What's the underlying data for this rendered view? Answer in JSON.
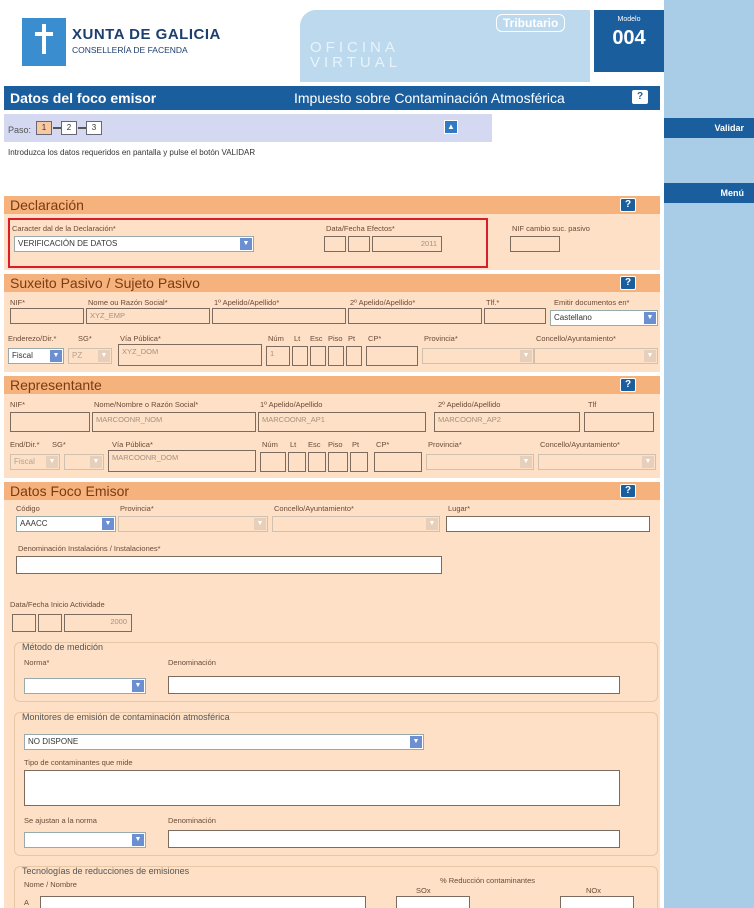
{
  "sidebar": {
    "validar": "Validar",
    "menu": "Menú"
  },
  "header": {
    "logo_title": "XUNTA DE GALICIA",
    "logo_sub": "CONSELLERÍA DE FACENDA",
    "oficina_l1": "OFICINA",
    "oficina_l2": "VIRTUAL",
    "tributario": "Tributario",
    "modelo_label": "Modelo",
    "modelo_num": "004"
  },
  "titlebar": {
    "left": "Datos del foco emisor",
    "right": "Impuesto sobre Contaminación Atmosférica",
    "help": "?"
  },
  "paso": {
    "label": "Paso:",
    "steps": [
      "1",
      "2",
      "3"
    ],
    "instructions": "Introduzca los datos requeridos en pantalla y pulse el botón VALIDAR"
  },
  "declaracion": {
    "title": "Declaración",
    "caracter_label": "Caracter dal de la Declaración*",
    "caracter_value": "VERIFICACIÓN DE DATOS",
    "data_label": "Data/Fecha Efectos*",
    "data_year": "2011",
    "nif_cambio_label": "NIF cambio suc. pasivo"
  },
  "sujeto": {
    "title": "Suxeito Pasivo / Sujeto Pasivo",
    "nif": "NIF*",
    "nome": "Nome ou Razón Social*",
    "nome_value": "XYZ_EMP",
    "ap1": "1º Apelido/Apellido*",
    "ap2": "2º Apelido/Apellido*",
    "tlf": "Tlf.*",
    "emitir": "Emitir documentos en*",
    "idioma": "Castellano",
    "enderezo": "Enderezo/Dir.*",
    "sg": "SG*",
    "enderezo_value": "Fiscal",
    "sg_value": "PZ",
    "via": "Vía Pública*",
    "via_value": "XYZ_DOM",
    "num": "Núm",
    "lt": "Lt",
    "esc": "Esc",
    "piso": "Piso",
    "pt": "Pt",
    "cp": "CP*",
    "provincia": "Provincia*",
    "concello": "Concello/Ayuntamiento*",
    "num_value": "1"
  },
  "representante": {
    "title": "Representante",
    "nif": "NIF*",
    "nome": "Nome/Nombre o Razón Social*",
    "nome_value": "MARCOONR_NOM",
    "ap1": "1º Apelido/Apellido",
    "ap1_value": "MARCOONR_AP1",
    "ap2": "2º Apelido/Apellido",
    "ap2_value": "MARCOONR_AP2",
    "tlf": "Tlf",
    "enderezo": "End/Dir.*",
    "sg": "SG*",
    "enderezo_value": "Fiscal",
    "via": "Vía Pública*",
    "via_value": "MARCOONR_DOM",
    "num": "Núm",
    "lt": "Lt",
    "esc": "Esc",
    "piso": "Piso",
    "pt": "Pt",
    "cp": "CP*",
    "provincia": "Provincia*",
    "concello": "Concello/Ayuntamiento*"
  },
  "foco": {
    "title": "Datos Foco Emisor",
    "codigo": "Código",
    "codigo_value": "AAACC",
    "provincia": "Provincia*",
    "concello": "Concello/Ayuntamiento*",
    "lugar": "Lugar*",
    "denominacion": "Denominación Instalacións / Instalaciones*",
    "data_inicio": "Data/Fecha Inicio Actividade",
    "data_year": "2000",
    "metodo": {
      "title": "Método de medición",
      "norma": "Norma*",
      "denominacion": "Denominación"
    },
    "monitores": {
      "title": "Monitores de emisión de contaminación atmosférica",
      "value": "NO DISPONE",
      "tipo": "Tipo de contaminantes que mide",
      "ajustan": "Se ajustan a la norma",
      "denominacion": "Denominación"
    },
    "tecnologias": {
      "title": "Tecnologías de reducciones de emisiones",
      "nome": "Nome / Nombre",
      "reduccion": "% Reducción contaminantes",
      "sox": "SOx",
      "nox": "NOx",
      "row_label": "A"
    }
  }
}
